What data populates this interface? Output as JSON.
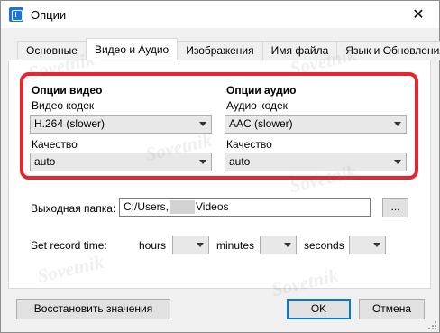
{
  "window": {
    "title": "Опции",
    "close_glyph": "✕"
  },
  "tabs": [
    {
      "label": "Основные",
      "active": false
    },
    {
      "label": "Видео и Аудио",
      "active": true
    },
    {
      "label": "Изображения",
      "active": false
    },
    {
      "label": "Имя файла",
      "active": false
    },
    {
      "label": "Язык и Обновления",
      "active": false
    }
  ],
  "video": {
    "section_title": "Опции видео",
    "codec_label": "Видео кодек",
    "codec_value": "H.264 (slower)",
    "quality_label": "Качество",
    "quality_value": "auto"
  },
  "audio": {
    "section_title": "Опции аудио",
    "codec_label": "Аудио кодек",
    "codec_value": "AAC (slower)",
    "quality_label": "Качество",
    "quality_value": "auto"
  },
  "output": {
    "label": "Выходная папка:",
    "path_prefix": "C:/Users,",
    "path_suffix": "Videos",
    "browse_label": "..."
  },
  "record_time": {
    "label": "Set record time:",
    "hours_label": "hours",
    "minutes_label": "minutes",
    "seconds_label": "seconds"
  },
  "footer": {
    "restore_label": "Восстановить значения",
    "ok_label": "OK",
    "cancel_label": "Отмена"
  },
  "watermark_text": "Sovetnik"
}
